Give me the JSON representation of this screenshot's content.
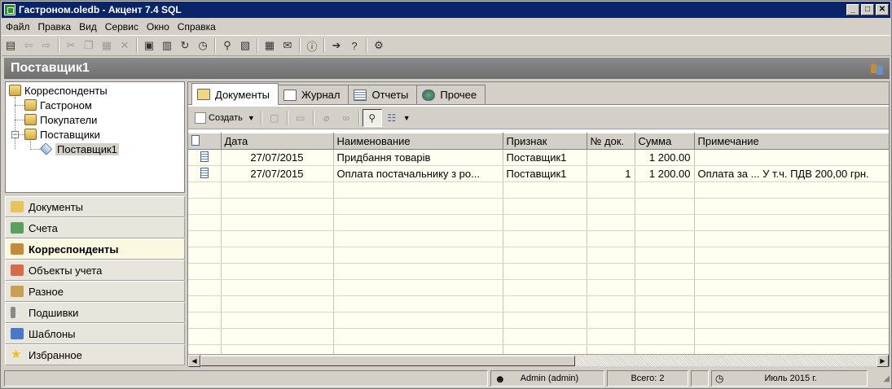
{
  "window": {
    "title": "Гастроном.oledb - Акцент 7.4 SQL",
    "buttons": {
      "minimize": "_",
      "maximize": "□",
      "close": "✕"
    }
  },
  "menu": [
    "Файл",
    "Правка",
    "Вид",
    "Сервис",
    "Окно",
    "Справка"
  ],
  "header": {
    "title": "Поставщик1"
  },
  "tree": {
    "root": "Корреспонденты",
    "items": [
      "Гастроном",
      "Покупатели",
      "Поставщики"
    ],
    "child": "Поставщик1"
  },
  "nav": [
    {
      "label": "Документы",
      "color": "#e8c35a"
    },
    {
      "label": "Счета",
      "color": "#5aa05a"
    },
    {
      "label": "Корреспонденты",
      "color": "#c58b3b"
    },
    {
      "label": "Объекты учета",
      "color": "#d86a4a"
    },
    {
      "label": "Разное",
      "color": "#c8a050"
    },
    {
      "label": "Подшивки",
      "color": "#8a8a8a"
    },
    {
      "label": "Шаблоны",
      "color": "#4a78c8"
    },
    {
      "label": "Избранное",
      "color": "#f0c020"
    }
  ],
  "tabs": [
    "Документы",
    "Журнал",
    "Отчеты",
    "Прочее"
  ],
  "subtoolbar": {
    "create_label": "Создать"
  },
  "table": {
    "columns": [
      "Дата",
      "Наименование",
      "Признак",
      "№ док.",
      "Сумма",
      "Примечание"
    ],
    "rows": [
      {
        "date": "27/07/2015",
        "name": "Придбання товарів",
        "sign": "Поставщик1",
        "num": "",
        "sum": "1 200.00",
        "note": ""
      },
      {
        "date": "27/07/2015",
        "name": "Оплата постачальнику з ро...",
        "sign": "Поставщик1",
        "num": "1",
        "sum": "1 200.00",
        "note": "Оплата за ... У т.ч. ПДВ 200,00 грн."
      }
    ]
  },
  "status": {
    "user": "Admin (admin)",
    "total": "Всего: 2",
    "period": "Июль 2015 г."
  }
}
